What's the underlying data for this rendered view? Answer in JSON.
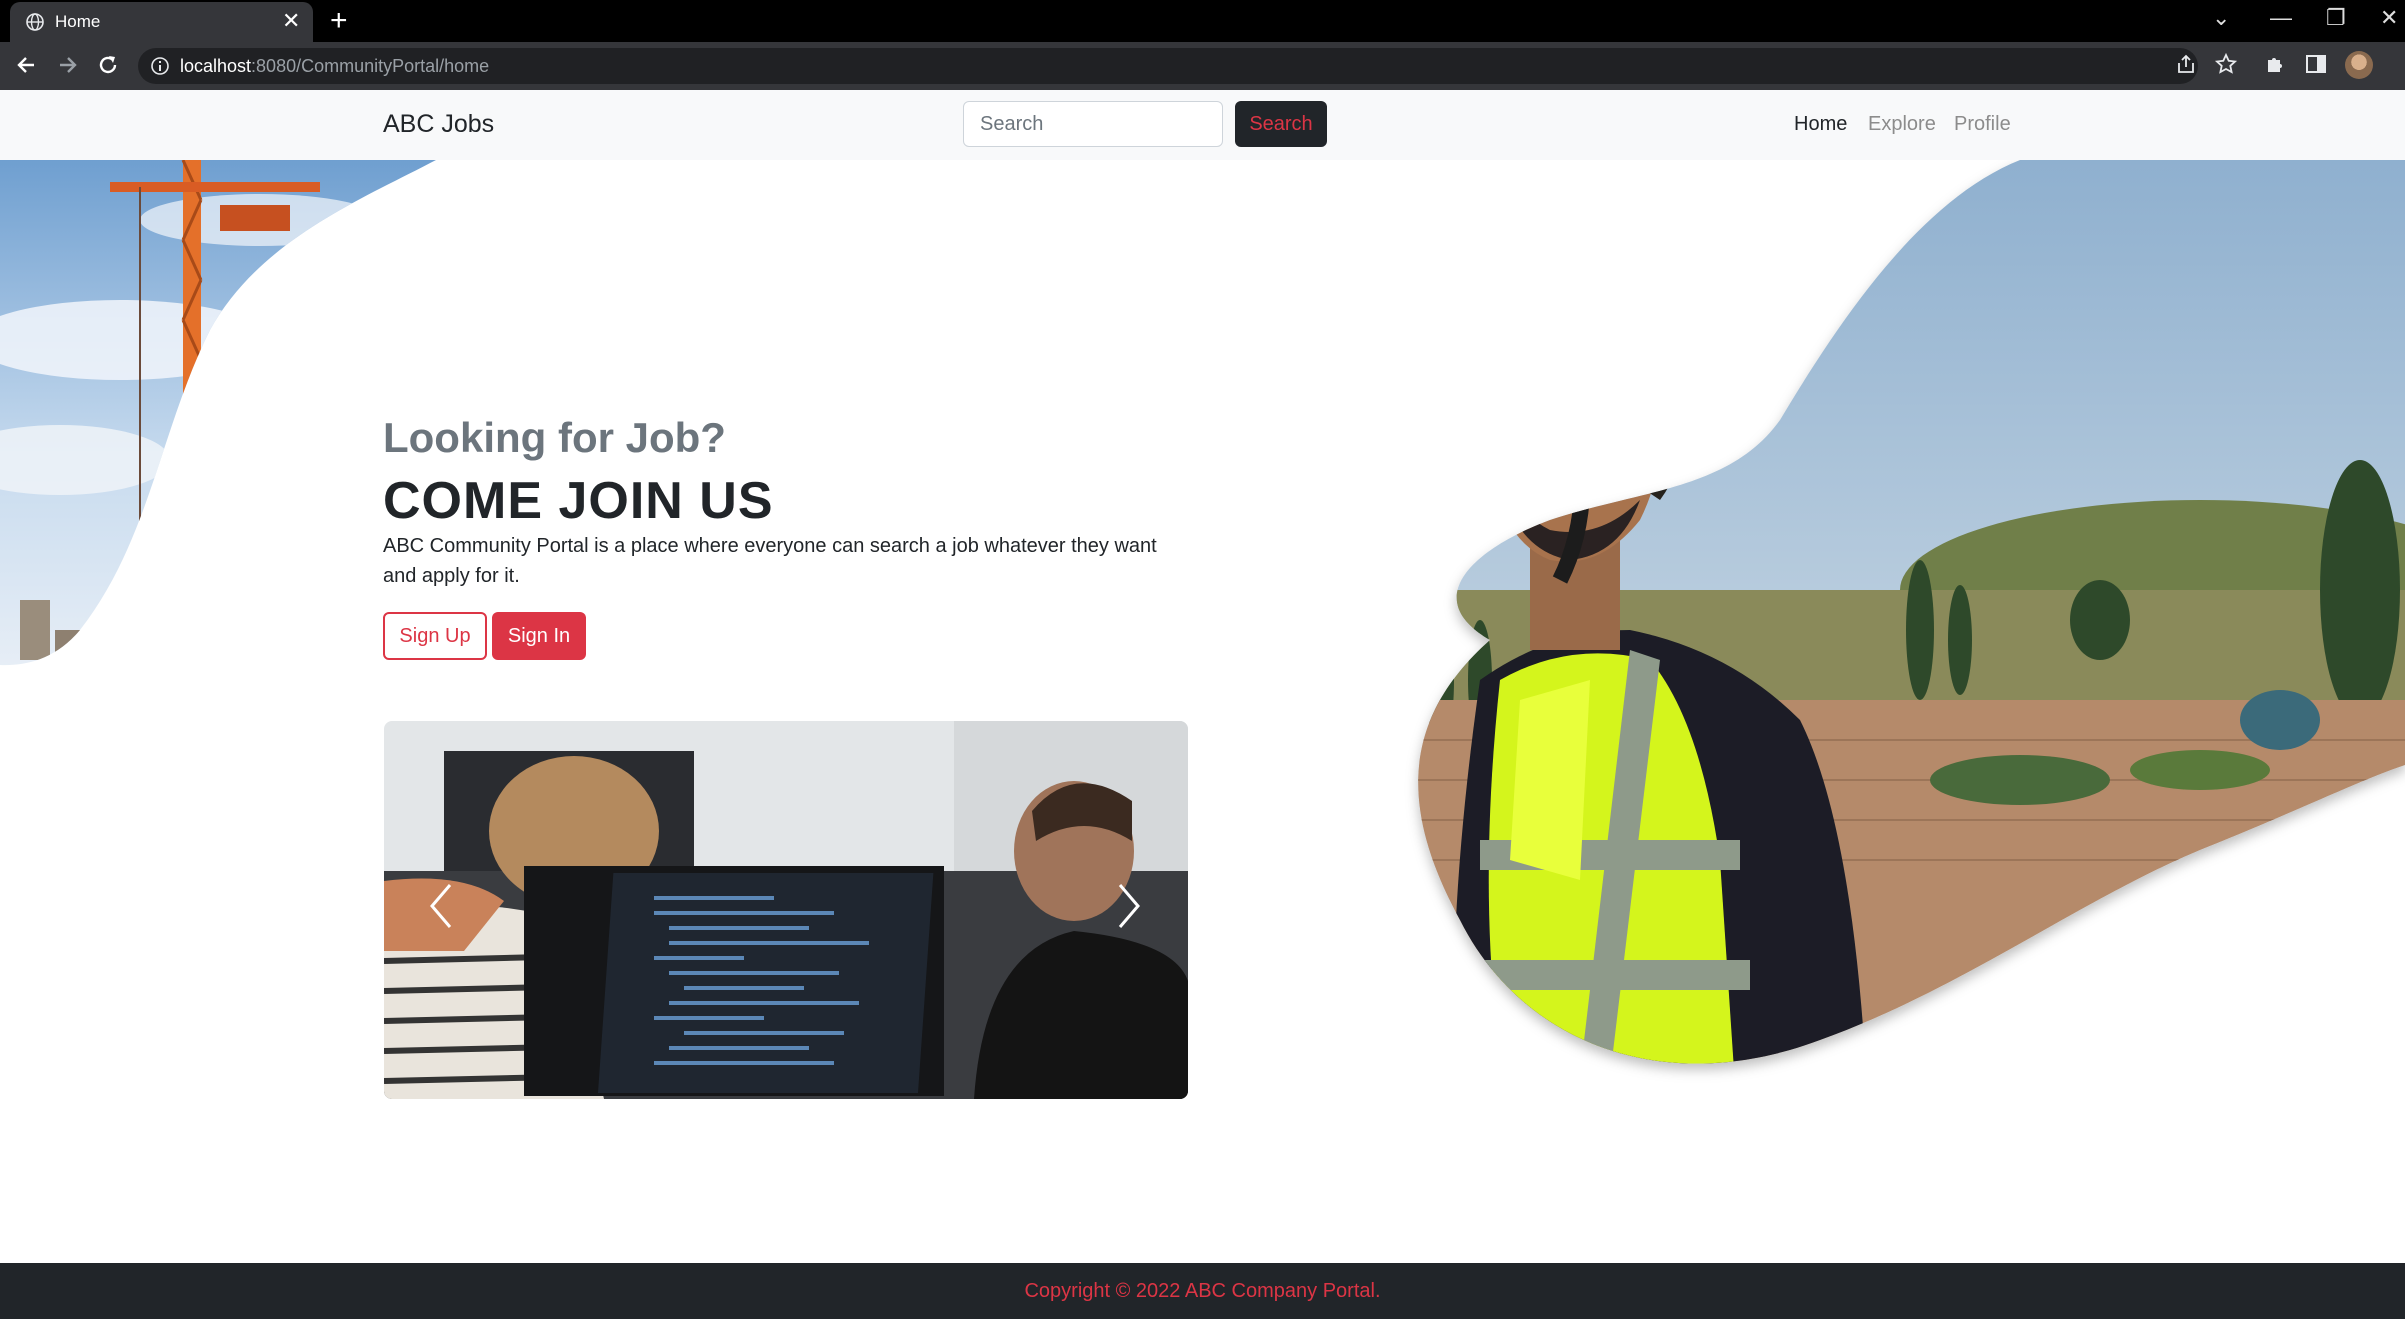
{
  "browser": {
    "tab_title": "Home",
    "tab_close": "✕",
    "new_tab": "+",
    "url_host": "localhost",
    "url_rest": ":8080/CommunityPortal/home",
    "window_controls": {
      "dropdown": "⌄",
      "minimize": "—",
      "restore": "❐",
      "close": "✕"
    }
  },
  "navbar": {
    "brand": "ABC Jobs",
    "search_placeholder": "Search",
    "search_button": "Search",
    "links": [
      "Home",
      "Explore",
      "Profile"
    ],
    "active_link": "Home"
  },
  "hero": {
    "subtitle": "Looking for Job?",
    "title": "COME JOIN US",
    "description": "ABC Community Portal is a place where everyone can search a job whatever they want and apply for it.",
    "signup_button": "Sign Up",
    "signin_button": "Sign In"
  },
  "footer": {
    "copyright": "Copyright © 2022 ABC Company Portal."
  },
  "colors": {
    "accent": "#dc3545",
    "navbar_bg": "#f8f9fa",
    "footer_bg": "#212529",
    "chrome_bg": "#35363a",
    "vest": "#d4f51b",
    "sky": "#b9cbd8"
  },
  "icons": [
    "globe-icon",
    "close-icon",
    "plus-icon",
    "back-arrow-icon",
    "forward-arrow-icon",
    "reload-icon",
    "info-icon",
    "share-icon",
    "star-icon",
    "puzzle-icon",
    "sidebar-icon",
    "chevron-left-icon",
    "chevron-right-icon"
  ]
}
